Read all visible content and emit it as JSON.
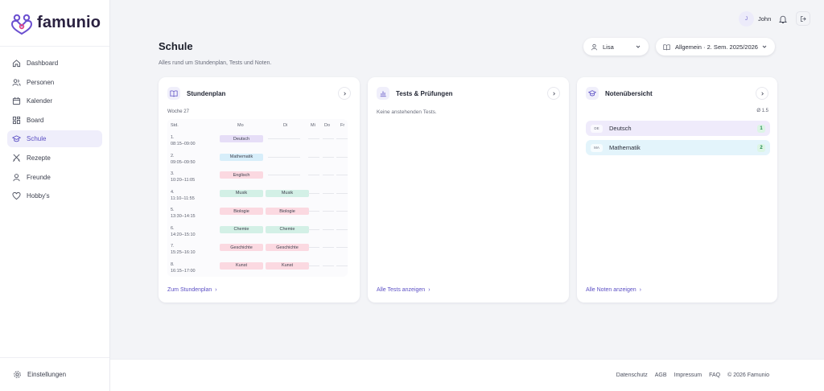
{
  "app": {
    "brand": "famunio"
  },
  "sidebar": {
    "items": [
      {
        "label": "Dashboard",
        "icon": "home-icon"
      },
      {
        "label": "Personen",
        "icon": "users-icon"
      },
      {
        "label": "Kalender",
        "icon": "calendar-icon"
      },
      {
        "label": "Board",
        "icon": "grid-icon"
      },
      {
        "label": "Schule",
        "icon": "graduation-cap-icon",
        "active": true
      },
      {
        "label": "Rezepte",
        "icon": "utensils-icon"
      },
      {
        "label": "Freunde",
        "icon": "user-icon"
      },
      {
        "label": "Hobby's",
        "icon": "heart-icon"
      }
    ],
    "settings_label": "Einstellungen"
  },
  "topbar": {
    "avatar_initial": "J",
    "user_name": "John"
  },
  "header": {
    "title": "Schule",
    "subtitle": "Alles rund um Stundenplan, Tests und Noten.",
    "person_select": "Lisa",
    "term_select": "Allgemein · 2. Sem. 2025/2026"
  },
  "timetable": {
    "title": "Stundenplan",
    "week": "Woche 27",
    "columns": [
      "Std.",
      "Mo",
      "Di",
      "Mi",
      "Do",
      "Fr"
    ],
    "rows": [
      {
        "num": "1.",
        "time": "08:15–09:00",
        "mo": "Deutsch",
        "di": ""
      },
      {
        "num": "2.",
        "time": "09:05–09:50",
        "mo": "Mathematik",
        "di": ""
      },
      {
        "num": "3.",
        "time": "10:20–11:05",
        "mo": "Englisch",
        "di": ""
      },
      {
        "num": "4.",
        "time": "11:10–11:55",
        "mo": "Musik",
        "di": "Musik"
      },
      {
        "num": "5.",
        "time": "13:30–14:15",
        "mo": "Biologie",
        "di": "Biologie"
      },
      {
        "num": "6.",
        "time": "14:20–15:10",
        "mo": "Chemie",
        "di": "Chemie"
      },
      {
        "num": "7.",
        "time": "15:25–16:10",
        "mo": "Geschichte",
        "di": "Geschichte"
      },
      {
        "num": "8.",
        "time": "16:15–17:00",
        "mo": "Kunst",
        "di": "Kunst"
      }
    ],
    "link": "Zum Stundenplan"
  },
  "tests": {
    "title": "Tests & Prüfungen",
    "empty": "Keine anstehenden Tests.",
    "link": "Alle Tests anzeigen"
  },
  "grades": {
    "title": "Notenübersicht",
    "average": "Ø 1.5",
    "items": [
      {
        "abbr": "DE",
        "name": "Deutsch",
        "count": "1"
      },
      {
        "abbr": "MA",
        "name": "Mathematik",
        "count": "2"
      }
    ],
    "link": "Alle Noten anzeigen"
  },
  "footer": {
    "links": [
      "Datenschutz",
      "AGB",
      "Impressum",
      "FAQ"
    ],
    "copyright": "© 2026 Famunio"
  },
  "colors": {
    "accent": "#5b4fc4",
    "deutsch": "#e6def7",
    "mathematik": "#d7eefa",
    "englisch": "#fbd9e1",
    "musik": "#d3f0e6",
    "biologie": "#fbd9e1",
    "chemie": "#d3f0e6",
    "geschichte": "#fbd9e1",
    "kunst": "#fbd9e1"
  }
}
